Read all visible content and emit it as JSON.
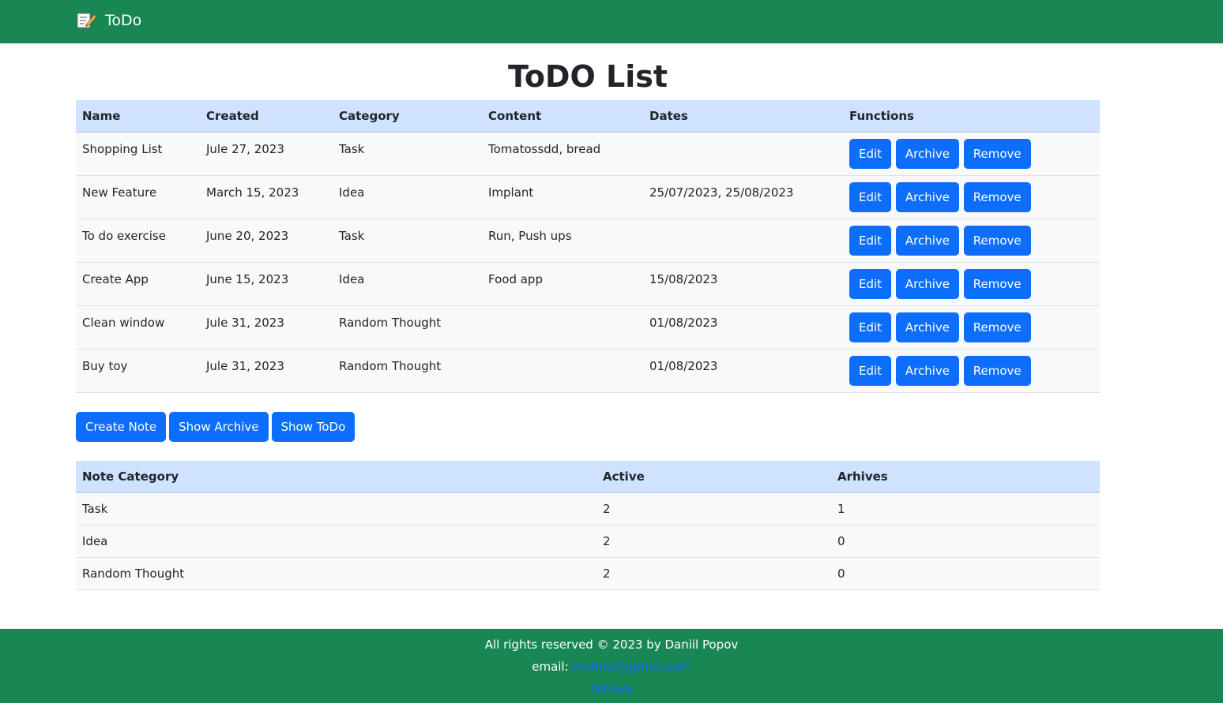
{
  "navbar": {
    "brand": "ToDo",
    "brand_icon": "memo-pencil-icon",
    "color": "#198754"
  },
  "page_title": "ToDO List",
  "notes_table": {
    "headers": [
      "Name",
      "Created",
      "Category",
      "Content",
      "Dates",
      "Functions"
    ],
    "rows": [
      {
        "name": "Shopping List",
        "created": "Jule 27, 2023",
        "category": "Task",
        "content": "Tomatossdd, bread",
        "dates": ""
      },
      {
        "name": "New Feature",
        "created": "March 15, 2023",
        "category": "Idea",
        "content": "Implant",
        "dates": "25/07/2023, 25/08/2023"
      },
      {
        "name": "To do exercise",
        "created": "June 20, 2023",
        "category": "Task",
        "content": "Run, Push ups",
        "dates": ""
      },
      {
        "name": "Create App",
        "created": "June 15, 2023",
        "category": "Idea",
        "content": "Food app",
        "dates": "15/08/2023"
      },
      {
        "name": "Clean window",
        "created": "Jule 31, 2023",
        "category": "Random Thought",
        "content": "",
        "dates": "01/08/2023"
      },
      {
        "name": "Buy toy",
        "created": "Jule 31, 2023",
        "category": "Random Thought",
        "content": "",
        "dates": "01/08/2023"
      }
    ],
    "buttons": {
      "edit": "Edit",
      "archive": "Archive",
      "remove": "Remove"
    }
  },
  "actions": {
    "create_note": "Create Note",
    "show_archive": "Show Archive",
    "show_todo": "Show ToDo"
  },
  "summary_table": {
    "headers": [
      "Note Category",
      "Active",
      "Arhives"
    ],
    "rows": [
      {
        "category": "Task",
        "active": "2",
        "archived": "1"
      },
      {
        "category": "Idea",
        "active": "2",
        "archived": "0"
      },
      {
        "category": "Random Thought",
        "active": "2",
        "archived": "0"
      }
    ]
  },
  "footer": {
    "copyright": "All rights reserved © 2023 by Daniil Popov",
    "email_label": "email:",
    "email": "niuhrxd@gmail.com",
    "github": "GitHub"
  },
  "colors": {
    "primary": "#0d6efd",
    "success": "#198754",
    "table_header": "#cfe2ff"
  }
}
